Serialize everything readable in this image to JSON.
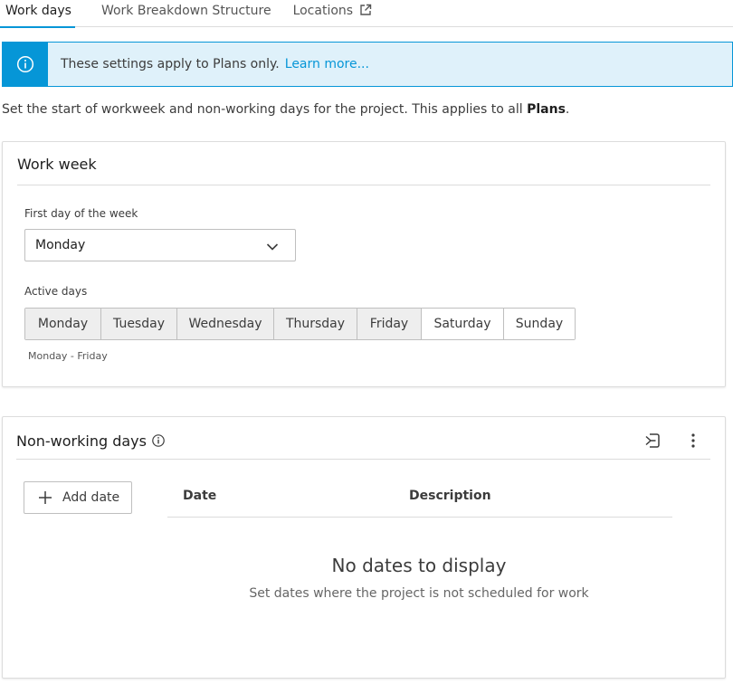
{
  "tabs": [
    {
      "label": "Work days",
      "active": true
    },
    {
      "label": "Work Breakdown Structure",
      "active": false
    },
    {
      "label": "Locations",
      "active": false,
      "external": true
    }
  ],
  "banner": {
    "icon": "info-icon",
    "message": "These settings apply to Plans only.",
    "link": "Learn more..."
  },
  "intro": {
    "text": "Set the start of workweek and non-working days for the project. This applies to all ",
    "bold": "Plans",
    "end": "."
  },
  "work_week": {
    "title": "Work week",
    "first_day_label": "First day of the week",
    "first_day_value": "Monday",
    "active_days_label": "Active days",
    "days": [
      {
        "label": "Monday",
        "active": true
      },
      {
        "label": "Tuesday",
        "active": true
      },
      {
        "label": "Wednesday",
        "active": true
      },
      {
        "label": "Thursday",
        "active": true
      },
      {
        "label": "Friday",
        "active": true
      },
      {
        "label": "Saturday",
        "active": false
      },
      {
        "label": "Sunday",
        "active": false
      }
    ],
    "summary": "Monday - Friday"
  },
  "non_working": {
    "title": "Non-working days",
    "add_button": "Add date",
    "columns": [
      "Date",
      "Description"
    ],
    "empty_title": "No dates to display",
    "empty_subtitle": "Set dates where the project is not scheduled for work"
  },
  "colors": {
    "accent": "#0696d7",
    "banner_bg": "#dff1fa",
    "active_day_bg": "#eeeeee"
  }
}
